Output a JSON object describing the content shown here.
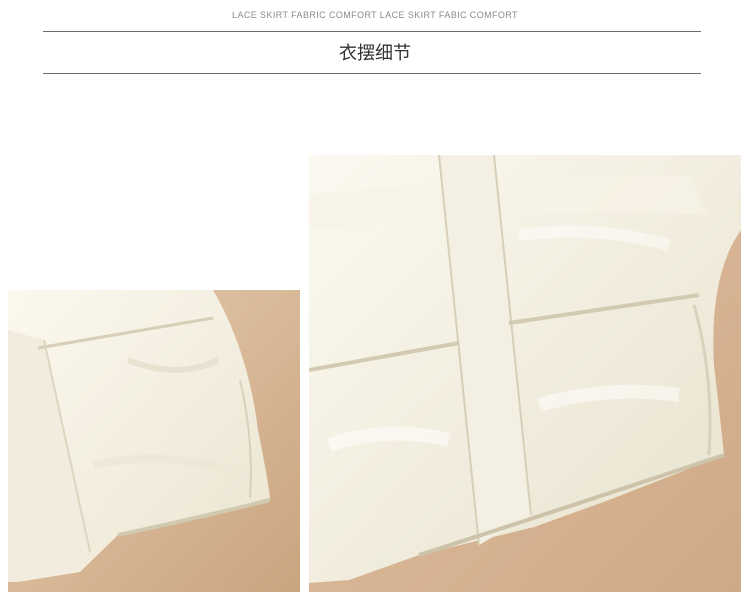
{
  "header": {
    "subtitle": "LACE SKIRT FABRIC COMFORT LACE SKIRT FABIC COMFORT",
    "title": "衣摆细节"
  },
  "images": {
    "left": {
      "subject": "jacket-hem-detail-left"
    },
    "right": {
      "subject": "jacket-hem-detail-right"
    }
  },
  "colors": {
    "background": "#ffffff",
    "rule": "#6b6b6b",
    "backdrop": "#d8b99a",
    "fabric": "#f5f1e4",
    "fabric_shadow": "#ddd6c2"
  }
}
